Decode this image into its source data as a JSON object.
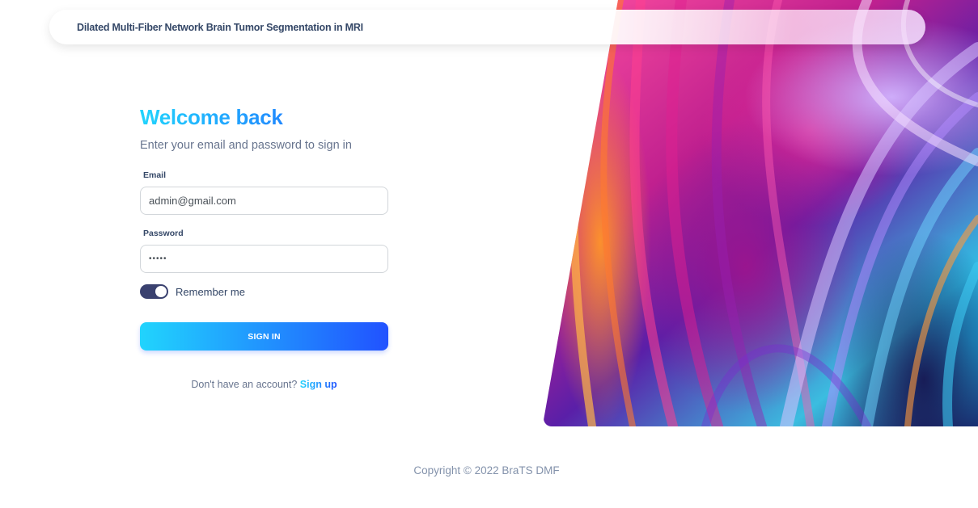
{
  "navbar": {
    "brand": "Dilated Multi-Fiber Network Brain Tumor Segmentation in MRI"
  },
  "signin": {
    "title": "Welcome back",
    "subtitle": "Enter your email and password to sign in",
    "email_label": "Email",
    "email_value": "admin@gmail.com",
    "password_label": "Password",
    "password_value": "•••••",
    "remember_label": "Remember me",
    "remember_checked": true,
    "submit_label": "SIGN IN",
    "signup_prompt": "Don't have an account?",
    "signup_link": "Sign up"
  },
  "footer": {
    "copyright": "Copyright © 2022 BraTS DMF"
  },
  "colors": {
    "accent_start": "#21d4fd",
    "accent_end": "#2152ff",
    "toggle_on": "#3a416f",
    "text_dark": "#344767",
    "text_muted": "#67748e"
  }
}
